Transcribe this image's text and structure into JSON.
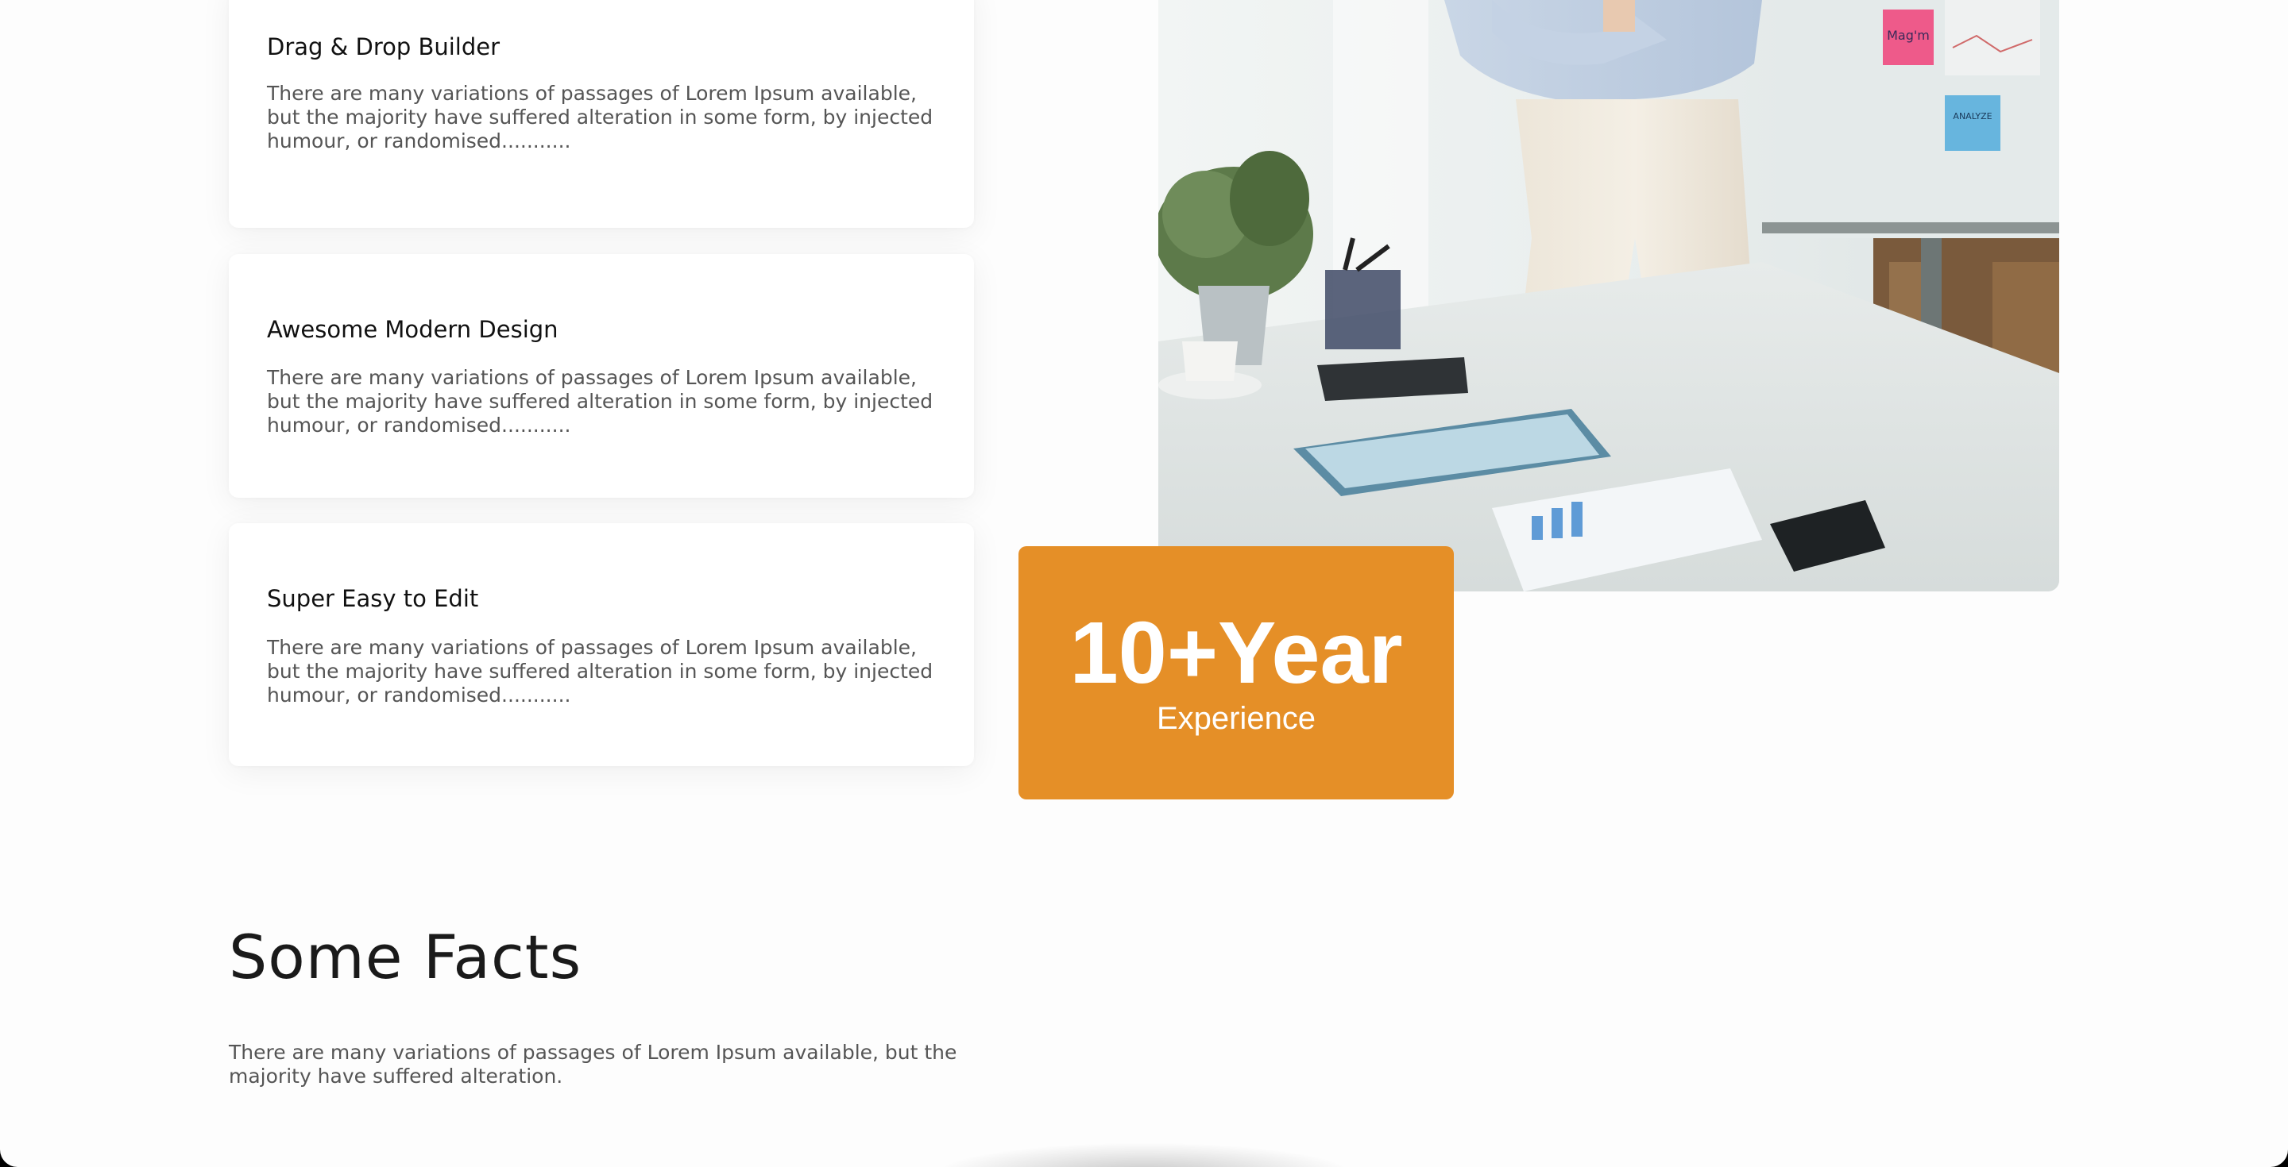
{
  "features": [
    {
      "title": "Drag & Drop Builder",
      "description": "There are many variations of passages of Lorem Ipsum available, but the majority have suffered alteration in some form, by injected humour, or randomised..........."
    },
    {
      "title": "Awesome Modern Design",
      "description": "There are many variations of passages of Lorem Ipsum available, but the majority have suffered alteration in some form, by injected humour, or randomised..........."
    },
    {
      "title": "Super Easy to Edit",
      "description": "There are many variations of passages of Lorem Ipsum available, but the majority have suffered alteration in some form, by injected humour, or randomised..........."
    }
  ],
  "experience": {
    "value": "10+Year",
    "label": "Experience",
    "color": "#e58f27"
  },
  "photo": {
    "sticky_note_pink": "Mag'm",
    "sticky_note_blue": "ANALYZE"
  },
  "facts": {
    "title": "Some Facts",
    "description": "There are many variations of passages of Lorem Ipsum available, but the majority have suffered alteration."
  }
}
